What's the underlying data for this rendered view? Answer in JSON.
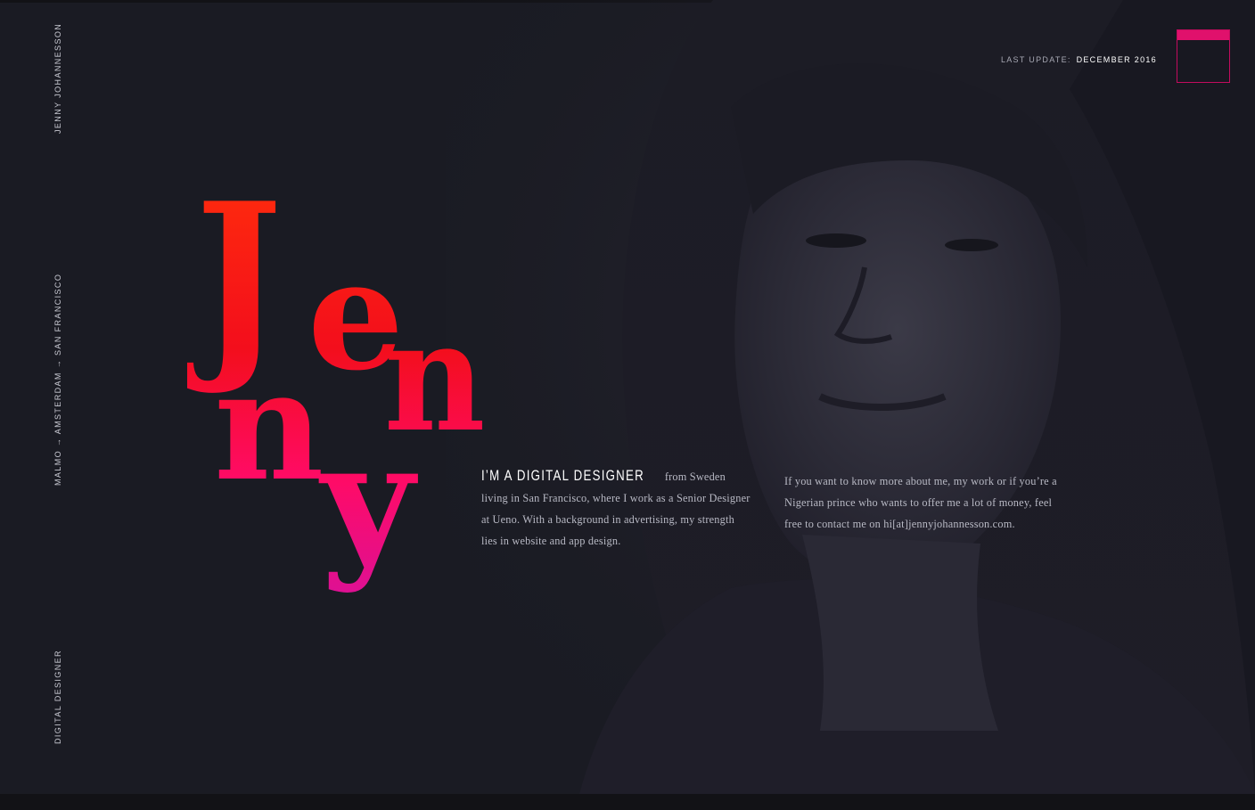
{
  "sidebar": {
    "name": "Jenny Johannesson",
    "route": "Malmo → Amsterdam → San Francisco",
    "role": "Digital Designer"
  },
  "header": {
    "last_update_label": "Last update:",
    "last_update_value": "December 2016"
  },
  "hero": {
    "name": "Jenny",
    "letters": [
      "J",
      "e",
      "n",
      "n",
      "y"
    ]
  },
  "intro": {
    "headline": "I’m a digital designer",
    "text": "from Sweden living in San Francisco, where I work as a Senior Designer at Ueno. With a background in advertising, my strength lies in website and app design."
  },
  "contact": {
    "text": "If you want to know more about me, my work or if you’re a Nigerian prince who wants to offer me a lot of money, feel free to contact me on hi[at]jennyjohannesson.com."
  },
  "colors": {
    "background": "#1a1b23",
    "accent": "#e0116c",
    "gradient_top": "#ff2a10",
    "gradient_bottom": "#e8118f"
  },
  "icons": {
    "menu": "menu-box-icon"
  }
}
